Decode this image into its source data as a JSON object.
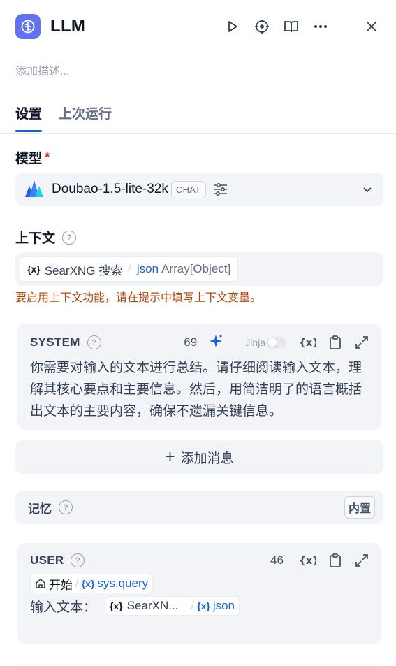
{
  "header": {
    "title": "LLM",
    "app_icon": "llm-brain-icon",
    "accent": "#6172f3",
    "actions": [
      "play-icon",
      "crosshair-icon",
      "book-open-icon",
      "more-icon",
      "close-icon"
    ]
  },
  "description_placeholder": "添加描述...",
  "tabs": [
    {
      "label": "设置",
      "active": true
    },
    {
      "label": "上次运行",
      "active": false
    }
  ],
  "model": {
    "label": "模型",
    "required_mark": "*",
    "name": "Doubao-1.5-lite-32k",
    "mode_badge": "CHAT"
  },
  "context": {
    "label": "上下文",
    "help": "?",
    "var_node": "SearXNG 搜索",
    "var_name": "json",
    "var_type": "Array[Object]",
    "warning": "要启用上下文功能，请在提示中填写上下文变量。"
  },
  "system_prompt": {
    "role": "SYSTEM",
    "help": "?",
    "count": "69",
    "jinja_label": "Jinja",
    "var_icon_label": "{x}",
    "text": "你需要对输入的文本进行总结。请仔细阅读输入文本，理解其核心要点和主要信息。然后，用简洁明了的语言概括出文本的主要内容，确保不遗漏关键信息。"
  },
  "add_message": {
    "plus": "+",
    "label": "添加消息"
  },
  "memory": {
    "label": "记忆",
    "help": "?",
    "badge": "内置"
  },
  "user_prompt": {
    "role": "USER",
    "help": "?",
    "count": "46",
    "var_icon_label": "{x}",
    "start_node": "开始",
    "start_var": "sys.query",
    "input_prefix": "输入文本：",
    "ctx_node": "SearXN...",
    "ctx_var": "json"
  },
  "colors": {
    "accent_blue": "#155eef",
    "warning": "#b54708",
    "panel_bg": "#f2f4f7"
  }
}
